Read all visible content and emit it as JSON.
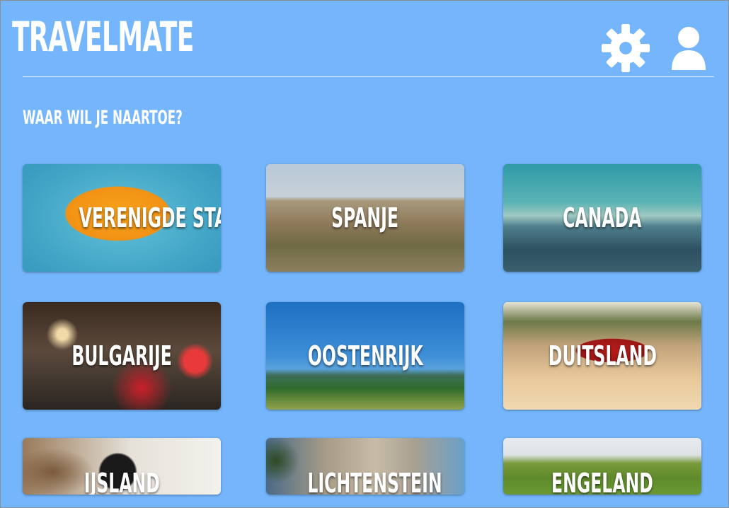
{
  "app": {
    "title": "TRAVELMATE"
  },
  "header": {
    "settings_icon": "gear-icon",
    "profile_icon": "user-icon"
  },
  "main": {
    "prompt": "WAAR WIL JE NAARTOE?",
    "destinations": [
      {
        "label": "VERENIGDE STATEN"
      },
      {
        "label": "SPANJE"
      },
      {
        "label": "CANADA"
      },
      {
        "label": "BULGARIJE"
      },
      {
        "label": "OOSTENRIJK"
      },
      {
        "label": "DUITSLAND"
      },
      {
        "label": "IJSLAND"
      },
      {
        "label": "LICHTENSTEIN"
      },
      {
        "label": "ENGELAND"
      }
    ]
  },
  "colors": {
    "background": "#74b5fb",
    "text": "#ffffff"
  }
}
